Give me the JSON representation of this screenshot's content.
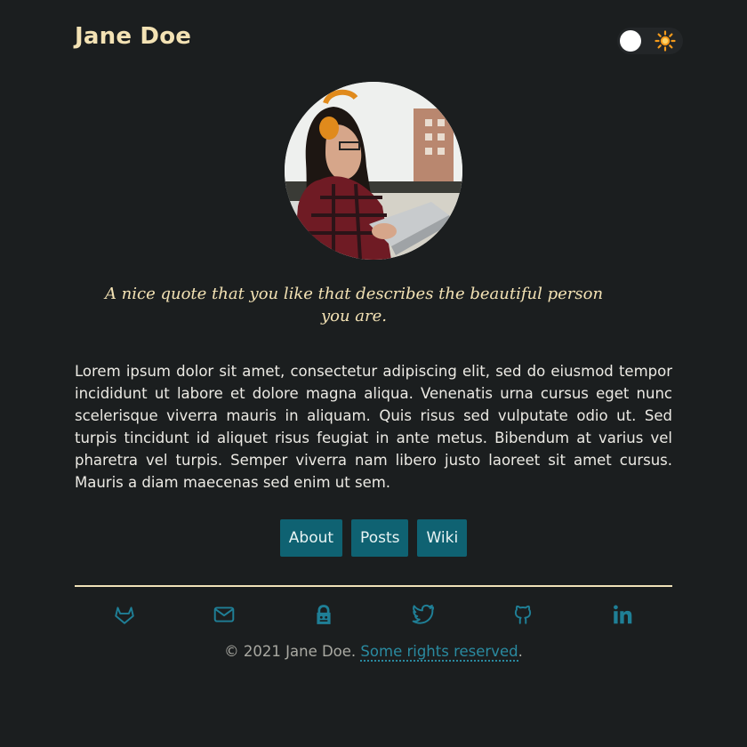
{
  "header": {
    "site_title": "Jane Doe",
    "theme_toggle": {
      "state": "dark",
      "icon": "sun-icon"
    }
  },
  "profile": {
    "avatar_alt": "avatar",
    "quote": "A nice quote that you like that describes the beautiful person you are.",
    "bio": "Lorem ipsum dolor sit amet, consectetur adipiscing elit, sed do eiusmod tempor incididunt ut labore et dolore magna aliqua. Venenatis urna cursus eget nunc scelerisque viverra mauris in aliquam. Quis risus sed vulputate odio ut. Sed turpis tincidunt id aliquet risus feugiat in ante metus. Bibendum at varius vel pharetra vel turpis. Semper viverra nam libero justo laoreet sit amet cursus. Mauris a diam maecenas sed enim ut sem."
  },
  "nav": {
    "items": [
      {
        "label": "About"
      },
      {
        "label": "Posts"
      },
      {
        "label": "Wiki"
      }
    ]
  },
  "socials": [
    "gitlab-icon",
    "mail-icon",
    "keybase-icon",
    "twitter-icon",
    "github-icon",
    "linkedin-icon"
  ],
  "footer": {
    "copyright": "© 2021 Jane Doe.",
    "rights_link": "Some rights reserved",
    "end": "."
  },
  "colors": {
    "background": "#1b1e1f",
    "title": "#f3e2b4",
    "button": "#0f6272",
    "icon": "#1f7f96",
    "link": "#2a8aa0"
  }
}
